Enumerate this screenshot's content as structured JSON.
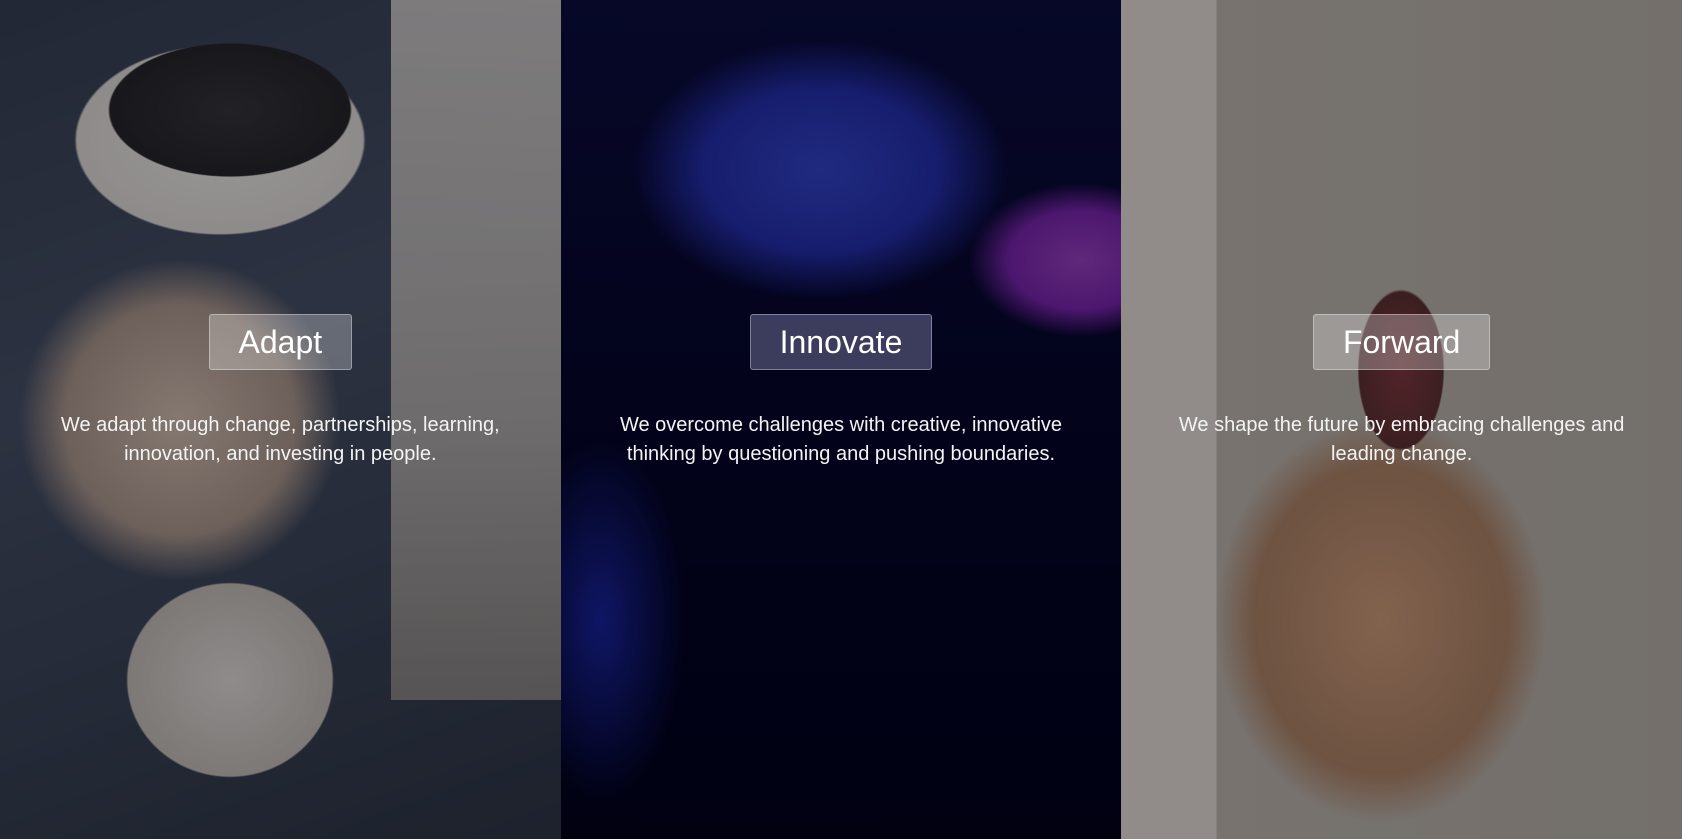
{
  "panels": [
    {
      "id": "adapt",
      "title": "Adapt",
      "description": "We adapt through change, partnerships, learning, innovation, and investing in people."
    },
    {
      "id": "innovate",
      "title": "Innovate",
      "description": "We overcome challenges with creative, innovative thinking by questioning and pushing boundaries."
    },
    {
      "id": "forward",
      "title": "Forward",
      "description": "We shape the future by embracing challenges and leading change."
    }
  ]
}
